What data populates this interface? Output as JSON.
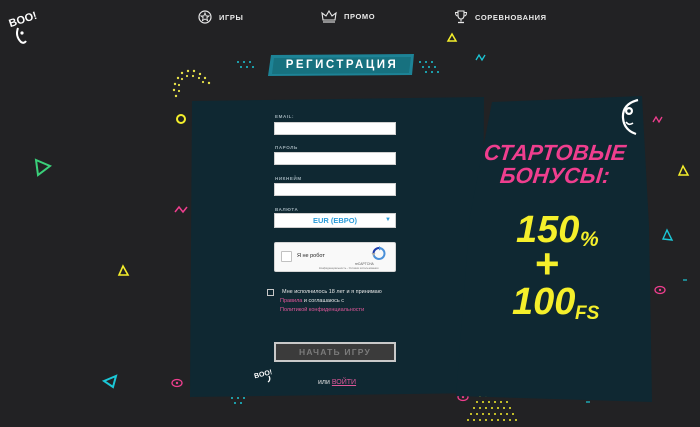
{
  "header": {
    "logo_text": "BOO!",
    "nav": [
      {
        "label": "ИГРЫ",
        "icon": "dice-icon"
      },
      {
        "label": "ПРОМО",
        "icon": "crown-icon"
      },
      {
        "label": "СОРЕВНОВАНИЯ",
        "icon": "trophy-icon"
      }
    ]
  },
  "registration": {
    "title": "РЕГИСТРАЦИЯ",
    "fields": [
      {
        "label": "EMAIL:",
        "value": ""
      },
      {
        "label": "ПАРОЛЬ",
        "value": ""
      },
      {
        "label": "НИКНЕЙМ",
        "value": ""
      }
    ],
    "currency_label": "ВАЛЮТА",
    "currency_value": "EUR (ЕВРО)",
    "captcha": {
      "label": "Я не робот",
      "brand": "reCAPTCHA",
      "links": "Конфиденциальность - Условия использования"
    },
    "agreement": {
      "line1": "Мне исполнилось 18 лет и я принимаю",
      "rules_link": "Правила",
      "line2_rest": " и соглашаюсь с",
      "privacy_link": "Политикой конфиденциальности"
    },
    "submit_label": "НАЧАТЬ ИГРУ",
    "or_text": "или ",
    "login_link": "ВОЙТИ"
  },
  "promo": {
    "line1": "СТАРТОВЫЕ",
    "line2": "БОНУСЫ:",
    "amount": "150",
    "percent": "%",
    "plus": "+",
    "spins": "100",
    "spins_unit": "FS"
  },
  "colors": {
    "background": "#222224",
    "panel": "#0f2832",
    "accent_pink": "#ef3e8e",
    "accent_yellow": "#f5ef2b",
    "accent_teal": "#1bc7d6",
    "banner": "#1d8396"
  }
}
